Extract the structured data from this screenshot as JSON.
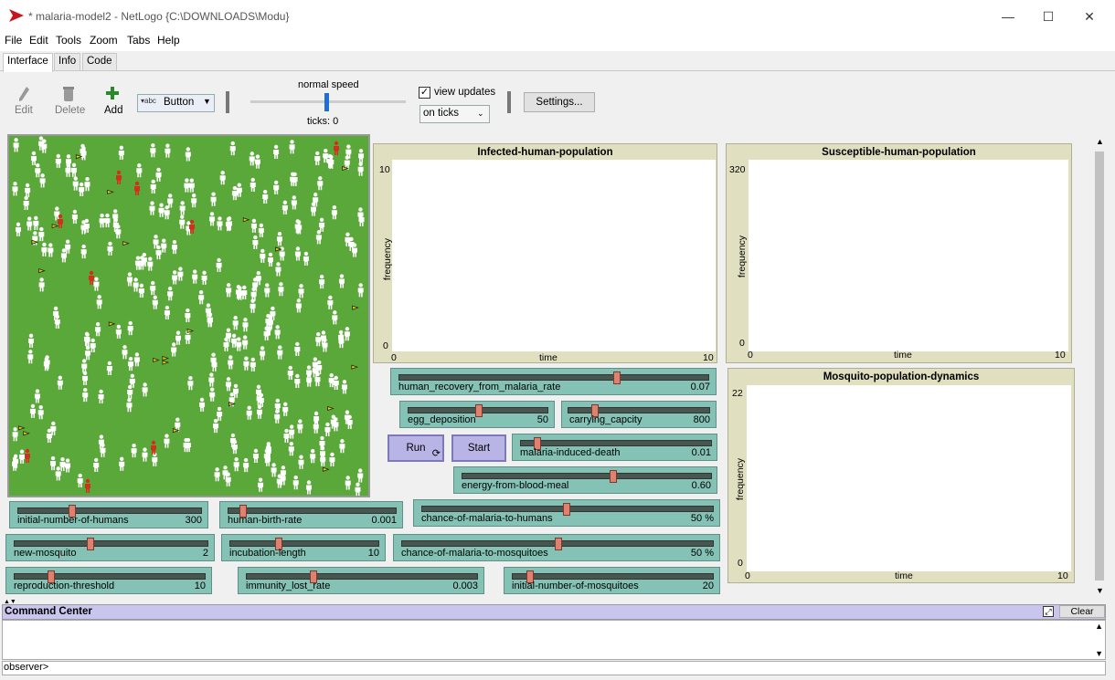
{
  "window": {
    "title": "* malaria-model2 - NetLogo {C:\\DOWNLOADS\\Modu}",
    "minimize": "—",
    "maximize": "☐",
    "close": "✕"
  },
  "menu": [
    "File",
    "Edit",
    "Tools",
    "Zoom",
    "Tabs",
    "Help"
  ],
  "tabs": [
    "Interface",
    "Info",
    "Code"
  ],
  "toolbar": {
    "edit": "Edit",
    "delete": "Delete",
    "add": "Add",
    "widget_type": "Button",
    "speed_label": "normal speed",
    "ticks": "ticks: 0",
    "view_updates": "view updates",
    "update_mode": "on ticks",
    "settings": "Settings..."
  },
  "plots": {
    "infected": {
      "title": "Infected-human-population",
      "ylabel": "frequency",
      "xlabel": "time",
      "ymax": "10",
      "ymin": "0",
      "xmin": "0",
      "xmax": "10"
    },
    "susceptible": {
      "title": "Susceptible-human-population",
      "ylabel": "frequency",
      "xlabel": "time",
      "ymax": "320",
      "ymin": "0",
      "xmin": "0",
      "xmax": "10"
    },
    "mosquito": {
      "title": "Mosquito-population-dynamics",
      "ylabel": "frequency",
      "xlabel": "time",
      "ymax": "22",
      "ymin": "0",
      "xmin": "0",
      "xmax": "10"
    }
  },
  "buttons": {
    "run": "Run",
    "start": "Start"
  },
  "sliders": {
    "human_recovery": {
      "name": "human_recovery_from_malaria_rate",
      "value": "0.07"
    },
    "egg_deposition": {
      "name": "egg_deposition",
      "value": "50"
    },
    "carrying_capcity": {
      "name": "carrying_capcity",
      "value": "800"
    },
    "malaria_death": {
      "name": "malaria-induced-death",
      "value": "0.01"
    },
    "energy_blood": {
      "name": "energy-from-blood-meal",
      "value": "0.60"
    },
    "initial_humans": {
      "name": "initial-number-of-humans",
      "value": "300"
    },
    "human_birth": {
      "name": "human-birth-rate",
      "value": "0.001"
    },
    "chance_humans": {
      "name": "chance-of-malaria-to-humans",
      "value": "50 %"
    },
    "new_mosquito": {
      "name": "new-mosquito",
      "value": "2"
    },
    "incubation": {
      "name": "incubation-length",
      "value": "10"
    },
    "chance_mosquitoes": {
      "name": "chance-of-malaria-to-mosquitoes",
      "value": "50 %"
    },
    "reproduction": {
      "name": "reproduction-threshold",
      "value": "10"
    },
    "immunity": {
      "name": "immunity_lost_rate",
      "value": "0.003"
    },
    "initial_mosquitoes": {
      "name": "initial-number-of-mosquitoes",
      "value": "20"
    }
  },
  "command_center": {
    "title": "Command Center",
    "clear": "Clear",
    "prompt": "observer>"
  },
  "colors": {
    "patch": "#5aa83a",
    "human": "#ffffff",
    "infected": "#d0301c",
    "mosquito": "#e8d000"
  }
}
